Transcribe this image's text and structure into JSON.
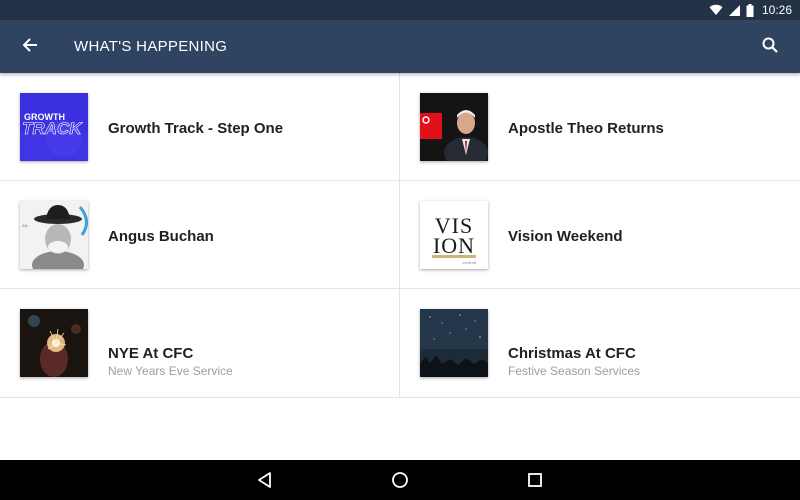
{
  "status_bar": {
    "time": "10:26",
    "icons": [
      "wifi-icon",
      "signal-icon",
      "battery-icon"
    ]
  },
  "app_bar": {
    "title": "WHAT'S HAPPENING",
    "back_icon": "arrow-back-icon",
    "search_icon": "search-icon",
    "background": "#2e4461"
  },
  "events": [
    {
      "title": "Growth Track - Step One",
      "subtitle": "",
      "thumb_text_top": "GROWTH",
      "thumb_text_bottom": "TRACK"
    },
    {
      "title": "Apostle Theo Returns",
      "subtitle": ""
    },
    {
      "title": "Angus Buchan",
      "subtitle": ""
    },
    {
      "title": "Vision Weekend",
      "subtitle": "",
      "thumb_text_top": "VIS",
      "thumb_text_bottom": "ION",
      "thumb_small": "weekend"
    },
    {
      "title": "NYE At CFC",
      "subtitle": "New Years Eve Service"
    },
    {
      "title": "Christmas At CFC",
      "subtitle": "Festive Season Services"
    }
  ],
  "nav_bar": {
    "icons": [
      "back-triangle-icon",
      "home-circle-icon",
      "recents-square-icon"
    ]
  }
}
